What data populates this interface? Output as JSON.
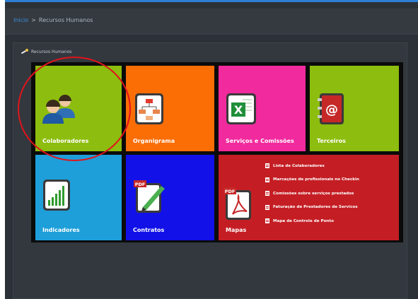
{
  "breadcrumb": {
    "home": "Inicio",
    "separator": ">",
    "current": "Recursos Humanos"
  },
  "panel": {
    "title": "Recursos Humanos",
    "icon": "tools-icon"
  },
  "tiles": {
    "colaboradores": {
      "label": "Colaboradores",
      "color": "#8dbd0e",
      "icon": "users-icon"
    },
    "organigrama": {
      "label": "Organigrama",
      "color": "#fb6d05",
      "icon": "org-chart-icon"
    },
    "servicos": {
      "label": "Serviços e Comissões",
      "color": "#f12a9e",
      "icon": "excel-icon"
    },
    "terceiros": {
      "label": "Terceiros",
      "color": "#8dbd0e",
      "icon": "address-book-icon"
    },
    "indicadores": {
      "label": "Indicadores",
      "color": "#1e9fda",
      "icon": "bar-chart-icon"
    },
    "contratos": {
      "label": "Contratos",
      "color": "#1111e8",
      "icon": "pdf-pen-icon"
    },
    "mapas": {
      "label": "Mapas",
      "color": "#c41e24",
      "icon": "pdf-icon",
      "items": [
        "Lista de Colaboradores",
        "Marcações de profissionais no Checkin",
        "Comissões sobre serviços prestados",
        "Faturação de Prestadores de Servicos",
        "Mapa de Controlo de Ponto"
      ]
    }
  },
  "icon_labels": {
    "excel": "X",
    "at": "@",
    "pdf": "PDF"
  },
  "annotation": {
    "color": "#e0141c"
  }
}
